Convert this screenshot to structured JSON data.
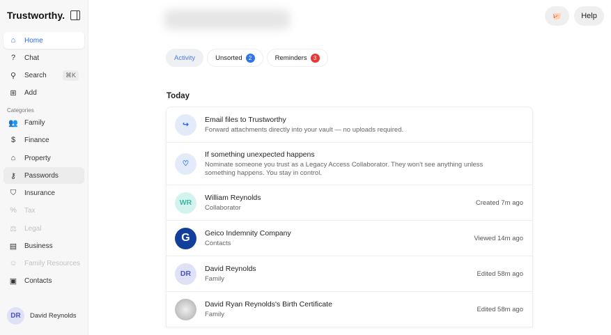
{
  "sidebar": {
    "logo": "Trustworthy.",
    "items": [
      {
        "label": "Home",
        "icon": "home-icon"
      },
      {
        "label": "Chat",
        "icon": "chat-icon"
      },
      {
        "label": "Search",
        "icon": "search-icon",
        "shortcut": "⌘K"
      },
      {
        "label": "Add",
        "icon": "plus-square-icon"
      }
    ],
    "categories_label": "Categories",
    "categories": [
      {
        "label": "Family"
      },
      {
        "label": "Finance"
      },
      {
        "label": "Property"
      },
      {
        "label": "Passwords"
      },
      {
        "label": "Insurance"
      },
      {
        "label": "Tax"
      },
      {
        "label": "Legal"
      },
      {
        "label": "Business"
      },
      {
        "label": "Family Resources"
      },
      {
        "label": "Contacts"
      }
    ],
    "user": {
      "initials": "DR",
      "name": "David Reynolds"
    }
  },
  "header": {
    "help": "Help"
  },
  "tabs": [
    {
      "label": "Activity"
    },
    {
      "label": "Unsorted",
      "count": "2"
    },
    {
      "label": "Reminders",
      "count": "3"
    }
  ],
  "section": "Today",
  "rows": [
    {
      "title": "Email files to Trustworthy",
      "subtitle": "Forward attachments directly into your vault — no uploads required."
    },
    {
      "title": "If something unexpected happens",
      "subtitle": "Nominate someone you trust as a Legacy Access Collaborator. They won't see anything unless something happens. You stay in control."
    },
    {
      "initials": "WR",
      "title": "William Reynolds",
      "subtitle": "Collaborator",
      "meta": "Created 7m ago"
    },
    {
      "title": "Geico Indemnity Company",
      "subtitle": "Contacts",
      "meta": "Viewed 14m ago"
    },
    {
      "initials": "DR",
      "title": "David Reynolds",
      "subtitle": "Family",
      "meta": "Edited 58m ago"
    },
    {
      "title": "David Ryan Reynolds's Birth Certificate",
      "subtitle": "Family",
      "meta": "Edited 58m ago"
    }
  ],
  "colors": {
    "accent": "#2b6bf0",
    "unsorted_badge": "#2f74e8",
    "reminders_badge": "#e53935"
  }
}
